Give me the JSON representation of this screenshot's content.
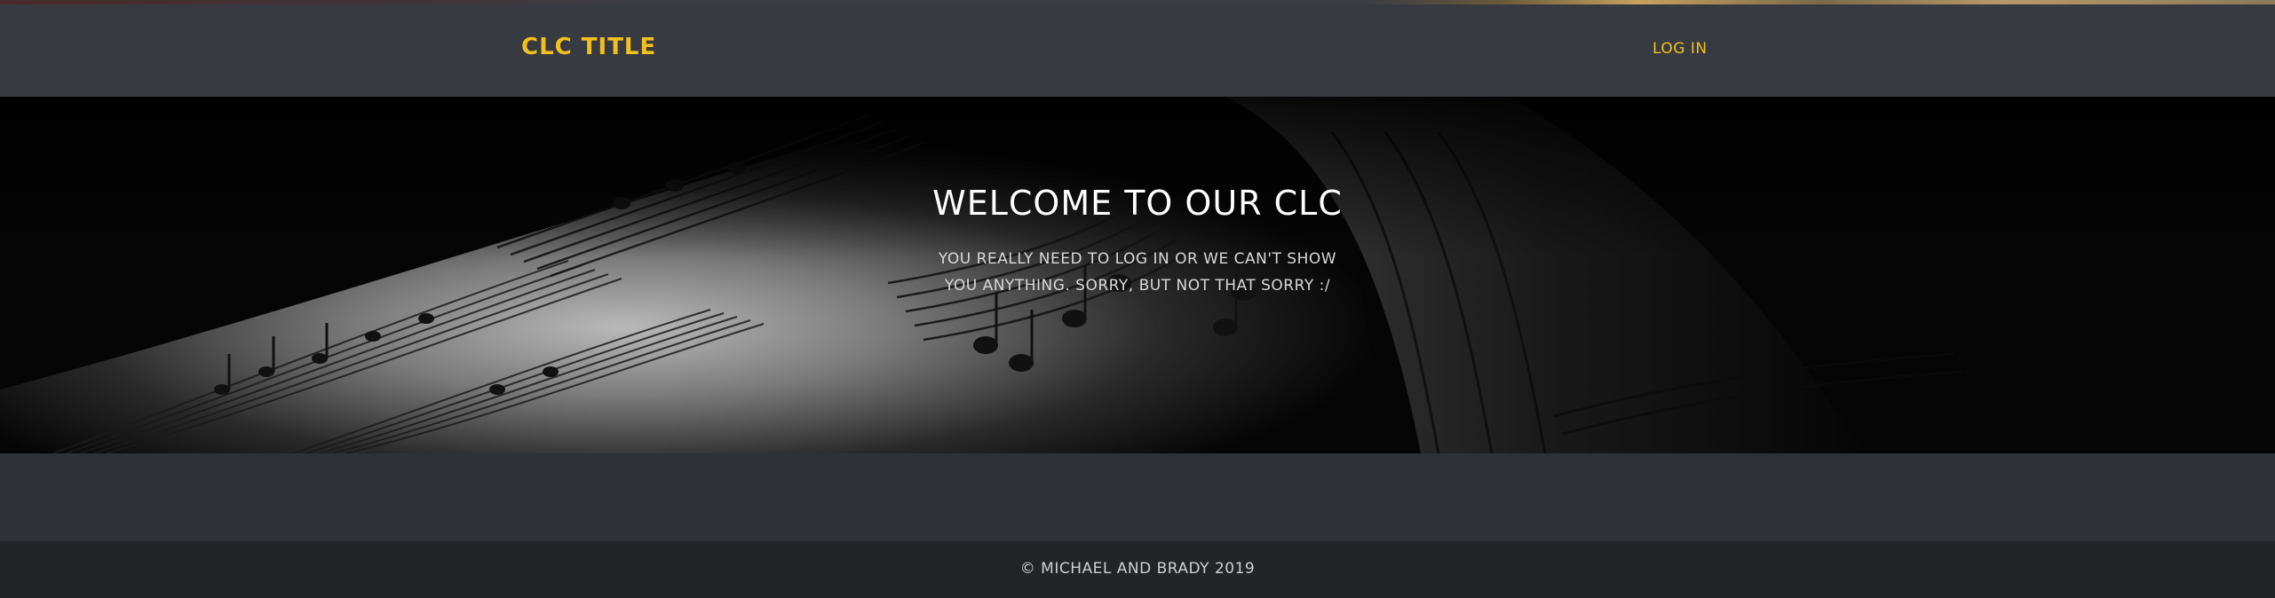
{
  "header": {
    "brand": "CLC TITLE",
    "login_label": "LOG IN"
  },
  "hero": {
    "title": "WELCOME TO OUR CLC",
    "message": "YOU REALLY NEED TO LOG IN OR WE CAN'T SHOW YOU ANYTHING. SORRY, BUT NOT THAT SORRY :/",
    "background_image": "sheet-music-photo"
  },
  "footer": {
    "copyright": "© MICHAEL AND BRADY 2019"
  },
  "colors": {
    "header_bg": "#373a40",
    "accent": "#f2c01e",
    "body_bg": "#2e3136",
    "footer_bg": "#222427"
  }
}
